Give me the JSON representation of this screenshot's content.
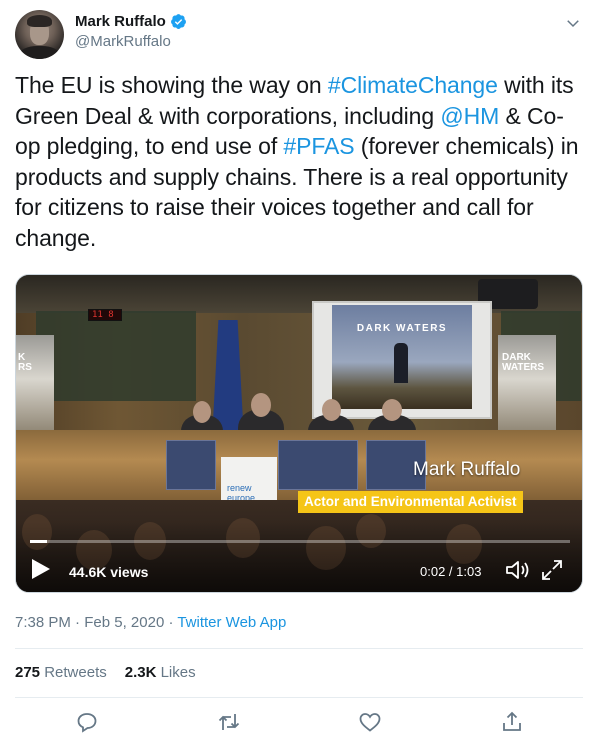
{
  "user": {
    "display_name": "Mark Ruffalo",
    "handle": "@MarkRuffalo",
    "verified": true
  },
  "tweet": {
    "segments": [
      {
        "text": "The EU is showing the way on ",
        "link": false
      },
      {
        "text": "#ClimateChange",
        "link": true
      },
      {
        "text": " with its Green Deal & with corporations, including ",
        "link": false
      },
      {
        "text": "@HM",
        "link": true
      },
      {
        "text": " & Co-op pledging, to end use of ",
        "link": false
      },
      {
        "text": "#PFAS",
        "link": true
      },
      {
        "text": " (forever chemicals) in products and supply chains. There is a real opportunity for citizens to raise their voices together and call for change.",
        "link": false
      }
    ]
  },
  "video": {
    "poster_title": "DARK WATERS",
    "side_banner_left": "K\nRS",
    "side_banner_right": "DARK\nWATERS",
    "desk_sign": "renew\neurope.",
    "clock_text": "11 8",
    "lower_third_name": "Mark Ruffalo",
    "lower_third_role": "Actor and Environmental Activist",
    "views": "44.6K views",
    "time": "0:02 / 1:03",
    "progress": 0.032
  },
  "meta": {
    "time": "7:38 PM",
    "separator": " · ",
    "date": "Feb 5, 2020",
    "source": "Twitter Web App"
  },
  "stats": {
    "retweets_count": "275",
    "retweets_label": "Retweets",
    "likes_count": "2.3K",
    "likes_label": "Likes"
  },
  "colors": {
    "link": "#1b95e0",
    "secondary_text": "#657786",
    "caption_highlight": "#f5c517"
  },
  "icons": [
    "verified-badge-icon",
    "chevron-down-icon",
    "play-icon",
    "volume-icon",
    "fullscreen-icon",
    "reply-icon",
    "retweet-icon",
    "like-icon",
    "share-icon"
  ]
}
